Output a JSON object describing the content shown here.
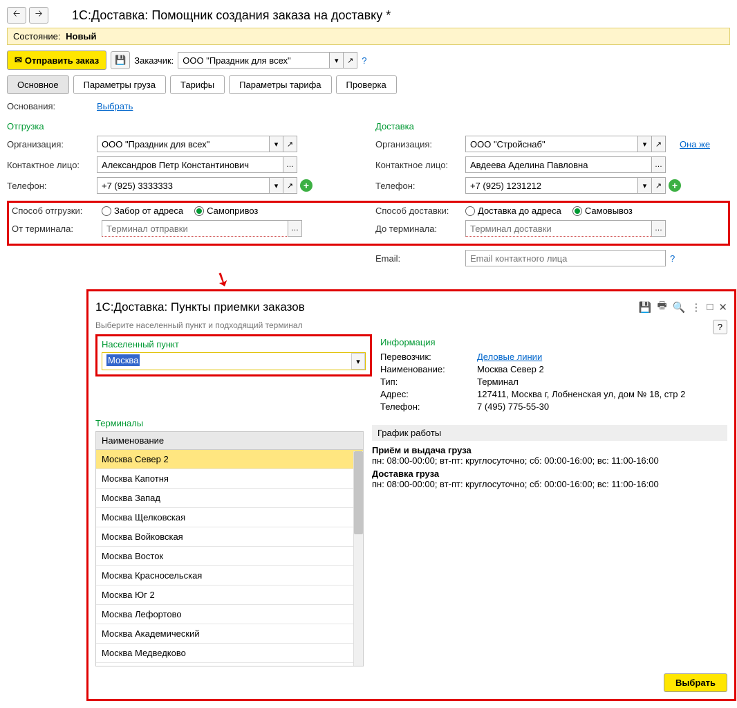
{
  "nav": {
    "back": "🡠",
    "fwd": "🡢"
  },
  "title": "1С:Доставка: Помощник создания заказа на доставку *",
  "status": {
    "label": "Состояние:",
    "value": "Новый"
  },
  "send_btn": "Отправить заказ",
  "customer_label": "Заказчик:",
  "customer_value": "ООО \"Праздник для всех\"",
  "tabs": {
    "main": "Основное",
    "cargo": "Параметры груза",
    "tariffs": "Тарифы",
    "tariff_params": "Параметры тарифа",
    "check": "Проверка"
  },
  "base": {
    "label": "Основания:",
    "link": "Выбрать"
  },
  "ship": {
    "title": "Отгрузка",
    "org_label": "Организация:",
    "org": "ООО \"Праздник для всех\"",
    "contact_label": "Контактное лицо:",
    "contact": "Александров Петр Константинович",
    "phone_label": "Телефон:",
    "phone": "+7 (925) 3333333",
    "method_label": "Способ отгрузки:",
    "opt1": "Забор от адреса",
    "opt2": "Самопривоз",
    "term_label": "От терминала:",
    "term_ph": "Терминал отправки"
  },
  "deliv": {
    "title": "Доставка",
    "org_label": "Организация:",
    "org": "ООО \"Стройснаб\"",
    "same": "Она же",
    "contact_label": "Контактное лицо:",
    "contact": "Авдеева Аделина Павловна",
    "phone_label": "Телефон:",
    "phone": "+7 (925) 1231212",
    "method_label": "Способ доставки:",
    "opt1": "Доставка до адреса",
    "opt2": "Самовывоз",
    "term_label": "До терминала:",
    "term_ph": "Терминал доставки",
    "email_label": "Email:",
    "email_ph": "Email контактного лица"
  },
  "dialog": {
    "title": "1С:Доставка: Пункты приемки заказов",
    "hint": "Выберите населенный пункт и подходящий терминал",
    "city_label": "Населенный пункт",
    "city_value": "Москва",
    "term_label": "Терминалы",
    "header": "Наименование",
    "rows": [
      "Москва Север 2",
      "Москва Капотня",
      "Москва Запад",
      "Москва Щелковская",
      "Москва Войковская",
      "Москва Восток",
      "Москва Красносельская",
      "Москва Юг 2",
      "Москва Лефортово",
      "Москва Академический",
      "Москва Медведково"
    ],
    "info_label": "Информация",
    "carrier_label": "Перевозчик:",
    "carrier": "Деловые линии",
    "name_label": "Наименование:",
    "name": "Москва Север 2",
    "type_label": "Тип:",
    "type": "Терминал",
    "addr_label": "Адрес:",
    "addr": "127411, Москва г, Лобненская ул, дом № 18, стр 2",
    "phone_label": "Телефон:",
    "phone": "7 (495) 775-55-30",
    "sched_label": "График работы",
    "recv_title": "Приём и выдача груза",
    "recv_text": "пн: 08:00-00:00; вт-пт: круглосуточно; сб: 00:00-16:00; вс: 11:00-16:00",
    "deliv_title": "Доставка груза",
    "deliv_text": "пн: 08:00-00:00; вт-пт: круглосуточно; сб: 00:00-16:00; вс: 11:00-16:00",
    "select": "Выбрать",
    "help": "?"
  }
}
